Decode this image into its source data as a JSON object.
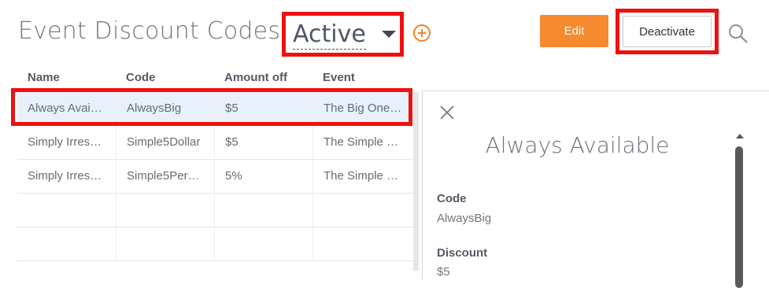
{
  "header": {
    "title": "Event Discount Codes:",
    "status_selected": "Active",
    "add_label": "",
    "edit_label": "Edit",
    "deactivate_label": "Deactivate"
  },
  "table": {
    "columns": [
      "Name",
      "Code",
      "Amount off",
      "Event"
    ],
    "rows": [
      {
        "name": "Always Avai…",
        "code": "AlwaysBig",
        "amount": "$5",
        "event": "The Big One…"
      },
      {
        "name": "Simply Irres…",
        "code": "Simple5Dollar",
        "amount": "$5",
        "event": "The Simple …"
      },
      {
        "name": "Simply Irres…",
        "code": "Simple5Per…",
        "amount": "5%",
        "event": "The Simple …"
      }
    ]
  },
  "detail": {
    "title": "Always Available",
    "code_label": "Code",
    "code_value": "AlwaysBig",
    "discount_label": "Discount",
    "discount_value": "$5"
  },
  "colors": {
    "accent": "#f58a2e",
    "highlight_border": "#ee1111",
    "selected_row": "#e8f1fb"
  }
}
